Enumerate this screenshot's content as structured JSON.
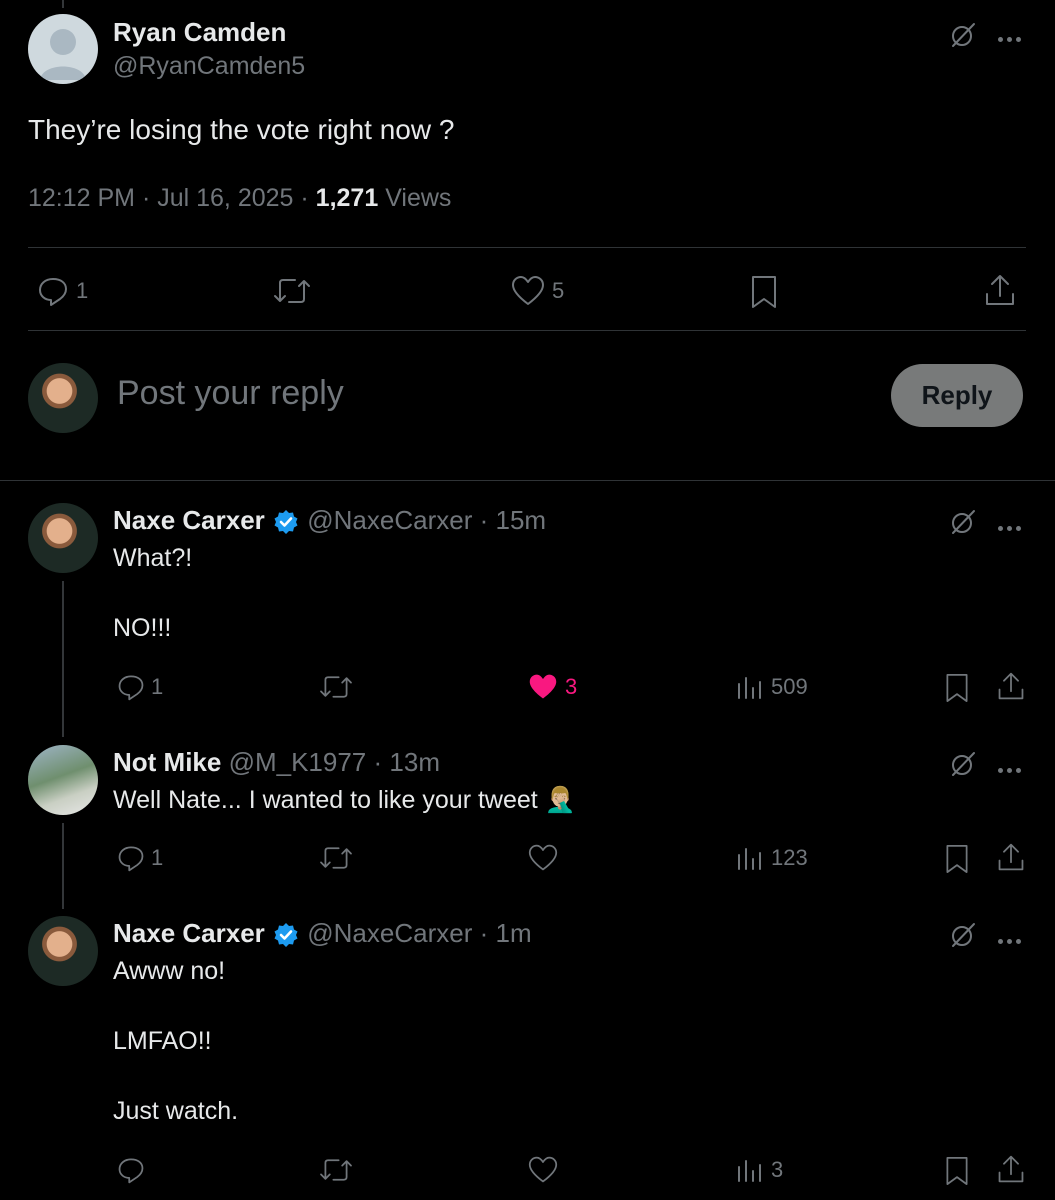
{
  "main_post": {
    "author_name": "Ryan Camden",
    "author_handle": "@RyanCamden5",
    "text": "They’re losing the vote right now ?",
    "time": "12:12 PM · Jul 16, 2025 ·",
    "views_count": "1,271",
    "views_label": "Views",
    "reply_count": "1",
    "like_count": "5"
  },
  "composer": {
    "placeholder": "Post your reply",
    "reply_button": "Reply"
  },
  "replies": [
    {
      "author_name": "Naxe Carxer",
      "author_handle": "@NaxeCarxer",
      "separator": "·",
      "age": "15m",
      "text": "What?!\n\nNO!!!",
      "reply_count": "1",
      "like_count": "3",
      "view_count": "509"
    },
    {
      "author_name": "Not Mike",
      "author_handle": "@M_K1977",
      "separator": "·",
      "age": "13m",
      "text": "Well Nate... I wanted to like your tweet 🤦🏼‍♂️",
      "reply_count": "1",
      "like_count": "",
      "view_count": "123"
    },
    {
      "author_name": "Naxe Carxer",
      "author_handle": "@NaxeCarxer",
      "separator": "·",
      "age": "1m",
      "text": "Awww no!\n\nLMFAO!!\n\nJust watch.",
      "reply_count": "",
      "like_count": "",
      "view_count": "3"
    }
  ],
  "colors": {
    "background": "#000000",
    "text": "#e7e9ea",
    "muted": "#71767b",
    "like_active": "#f91880",
    "verified": "#1d9bf0",
    "divider": "#2f3336",
    "reply_button_bg": "#787a7a"
  }
}
